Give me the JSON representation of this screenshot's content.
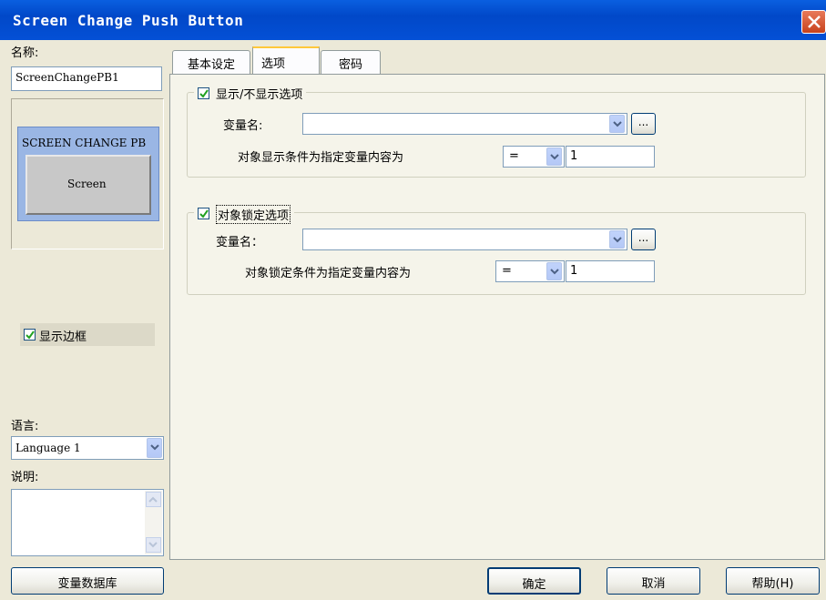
{
  "window": {
    "title": "Screen Change Push Button"
  },
  "left": {
    "name_label": "名称:",
    "name_value": "ScreenChangePB1",
    "preview_header": "SCREEN CHANGE PB",
    "preview_button": "Screen",
    "show_border_label": "显示边框",
    "language_label": "语言:",
    "language_value": "Language 1",
    "description_label": "说明:"
  },
  "tabs": [
    {
      "label": "基本设定",
      "active": false
    },
    {
      "label": "选项",
      "active": true
    },
    {
      "label": "密码",
      "active": false
    }
  ],
  "options": {
    "visibility_group": {
      "label": "显示/不显示选项",
      "checked": true,
      "variable_label": "变量名:",
      "variable_value": "",
      "condition_label": "对象显示条件为指定变量内容为",
      "operator": "=",
      "value": "1"
    },
    "lock_group": {
      "label": "对象锁定选项",
      "checked": true,
      "variable_label": "变量名：",
      "variable_value": "",
      "condition_label": "对象锁定条件为指定变量内容为",
      "operator": "=",
      "value": "1"
    },
    "browse_label": "..."
  },
  "footer": {
    "var_db_button": "变量数据库",
    "ok_button": "确定",
    "cancel_button": "取消",
    "help_button": "帮助(H)"
  }
}
